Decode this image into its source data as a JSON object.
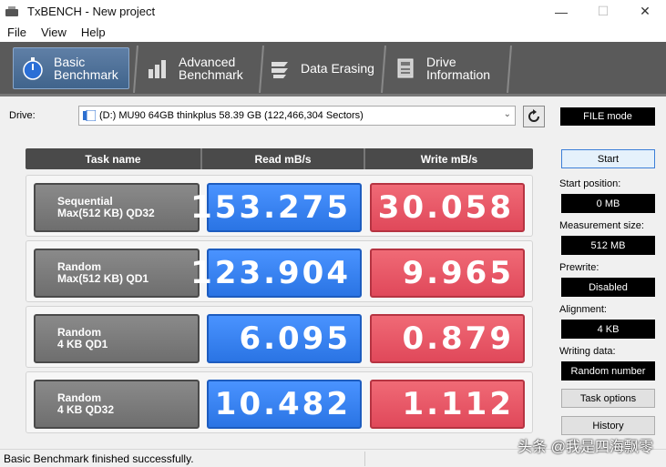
{
  "window": {
    "title": "TxBENCH - New project",
    "minimize": "—",
    "maximize": "☐",
    "close": "✕"
  },
  "menu": {
    "items": [
      "File",
      "View",
      "Help"
    ]
  },
  "tabs": [
    {
      "line1": "Basic",
      "line2": "Benchmark",
      "icon": "stopwatch-icon",
      "active": true
    },
    {
      "line1": "Advanced",
      "line2": "Benchmark",
      "icon": "bar-chart-icon",
      "active": false
    },
    {
      "line1": "Data Erasing",
      "line2": "",
      "icon": "eraser-icon",
      "active": false
    },
    {
      "line1": "Drive",
      "line2": "Information",
      "icon": "drive-info-icon",
      "active": false
    }
  ],
  "drive": {
    "label": "Drive:",
    "selected": "(D:) MU90 64GB thinkplus  58.39 GB (122,466,304 Sectors)",
    "mode": "FILE mode"
  },
  "table": {
    "headers": [
      "Task name",
      "Read mB/s",
      "Write mB/s"
    ],
    "rows": [
      {
        "task1": "Sequential",
        "task2": "Max(512 KB) QD32",
        "read": "153.275",
        "write": "30.058"
      },
      {
        "task1": "Random",
        "task2": "Max(512 KB) QD1",
        "read": "123.904",
        "write": "9.965"
      },
      {
        "task1": "Random",
        "task2": "4 KB QD1",
        "read": "6.095",
        "write": "0.879"
      },
      {
        "task1": "Random",
        "task2": "4 KB QD32",
        "read": "10.482",
        "write": "1.112"
      }
    ]
  },
  "side": {
    "start": "Start",
    "task_position_label": "Start position:",
    "task_position": "0 MB",
    "measurement_label": "Measurement size:",
    "measurement": "512 MB",
    "prewrite_label": "Prewrite:",
    "prewrite": "Disabled",
    "alignment_label": "Alignment:",
    "alignment": "4 KB",
    "writing_data_label": "Writing data:",
    "writing_data": "Random number",
    "task_options": "Task options",
    "history": "History"
  },
  "status": {
    "text": "Basic Benchmark finished successfully.",
    "watermark": "头条 @我是四海飘零"
  },
  "colors": {
    "read": "#2f7ff0",
    "write": "#e8525f",
    "tab_active": "#4d6f97"
  }
}
